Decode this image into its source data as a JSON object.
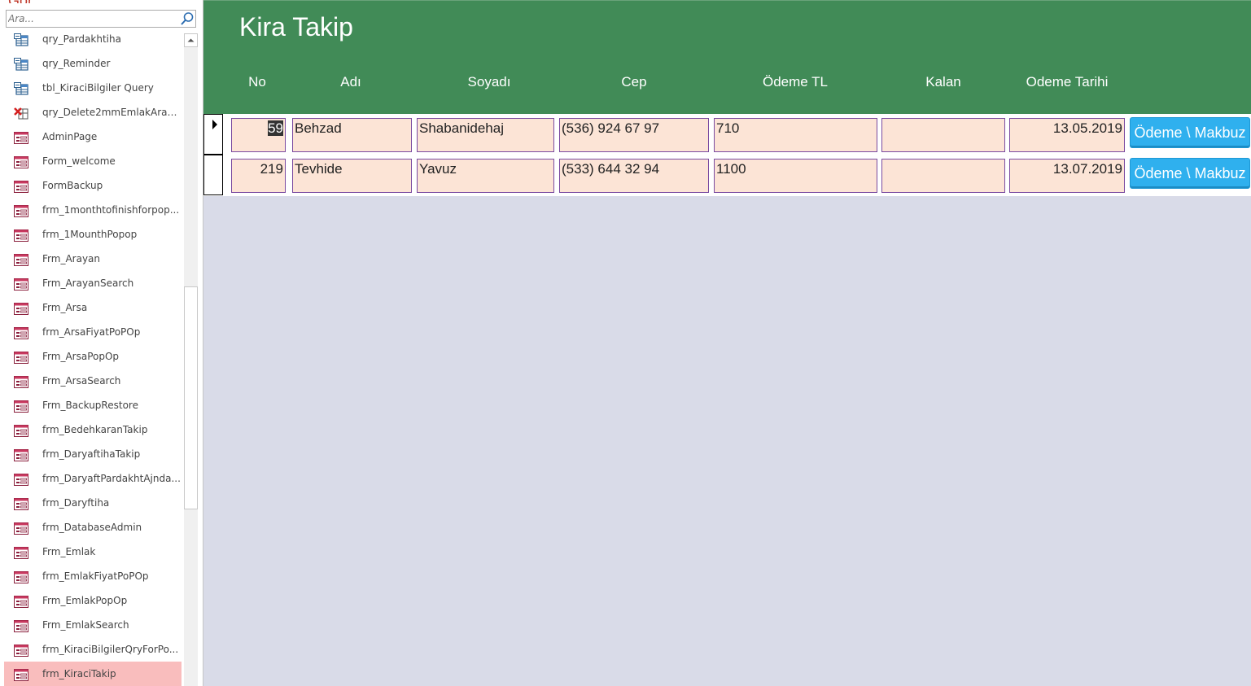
{
  "nav": {
    "search_placeholder": "Ara...",
    "items": [
      {
        "label": "qry_Pardakhtiha",
        "icon": "query-icon"
      },
      {
        "label": "qry_Reminder",
        "icon": "query-icon"
      },
      {
        "label": "tbl_KiraciBilgiler Query",
        "icon": "query-icon"
      },
      {
        "label": "qry_Delete2mmEmlakArayan",
        "icon": "delete-query-icon"
      },
      {
        "label": "AdminPage",
        "icon": "form-icon"
      },
      {
        "label": "Form_welcome",
        "icon": "form-icon"
      },
      {
        "label": "FormBackup",
        "icon": "form-icon"
      },
      {
        "label": "frm_1monthtofinishforpop...",
        "icon": "form-icon"
      },
      {
        "label": "frm_1MounthPopop",
        "icon": "form-icon"
      },
      {
        "label": "Frm_Arayan",
        "icon": "form-icon"
      },
      {
        "label": "Frm_ArayanSearch",
        "icon": "form-icon"
      },
      {
        "label": "Frm_Arsa",
        "icon": "form-icon"
      },
      {
        "label": "frm_ArsaFiyatPoPOp",
        "icon": "form-icon"
      },
      {
        "label": "Frm_ArsaPopOp",
        "icon": "form-icon"
      },
      {
        "label": "Frm_ArsaSearch",
        "icon": "form-icon"
      },
      {
        "label": "Frm_BackupRestore",
        "icon": "form-icon"
      },
      {
        "label": "frm_BedehkaranTakip",
        "icon": "form-icon"
      },
      {
        "label": "frm_DaryaftihaTakip",
        "icon": "form-icon"
      },
      {
        "label": "frm_DaryaftPardakhtAjnda...",
        "icon": "form-icon"
      },
      {
        "label": "frm_Daryftiha",
        "icon": "form-icon"
      },
      {
        "label": "frm_DatabaseAdmin",
        "icon": "form-icon"
      },
      {
        "label": "Frm_Emlak",
        "icon": "form-icon"
      },
      {
        "label": "frm_EmlakFiyatPoPOp",
        "icon": "form-icon"
      },
      {
        "label": "Frm_EmlakPopOp",
        "icon": "form-icon"
      },
      {
        "label": "Frm_EmlakSearch",
        "icon": "form-icon"
      },
      {
        "label": "frm_KiraciBilgilerQryForPo...",
        "icon": "form-icon"
      },
      {
        "label": "frm_KiraciTakip",
        "icon": "form-icon",
        "selected": true
      }
    ]
  },
  "form": {
    "title": "Kira Takip",
    "columns": [
      "No",
      "Adı",
      "Soyadı",
      "Cep",
      "Ödeme TL",
      "Kalan",
      "Odeme Tarihi"
    ],
    "button_label": "Ödeme \\ Makbuz",
    "records": [
      {
        "no": "59",
        "adi": "Behzad",
        "soyadi": "Shabanidehaj",
        "cep": "(536) 924 67 97",
        "odeme": "710",
        "kalan": "",
        "tarih": "13.05.2019",
        "current": true
      },
      {
        "no": "219",
        "adi": "Tevhide",
        "soyadi": "Yavuz",
        "cep": "(533) 644 32 94",
        "odeme": "1100",
        "kalan": "",
        "tarih": "13.07.2019"
      }
    ]
  },
  "colors": {
    "header_green": "#418b57",
    "field_fill": "#fce4d6",
    "button_blue": "#2fb0ee",
    "selected_nav": "#f9bdbd"
  }
}
